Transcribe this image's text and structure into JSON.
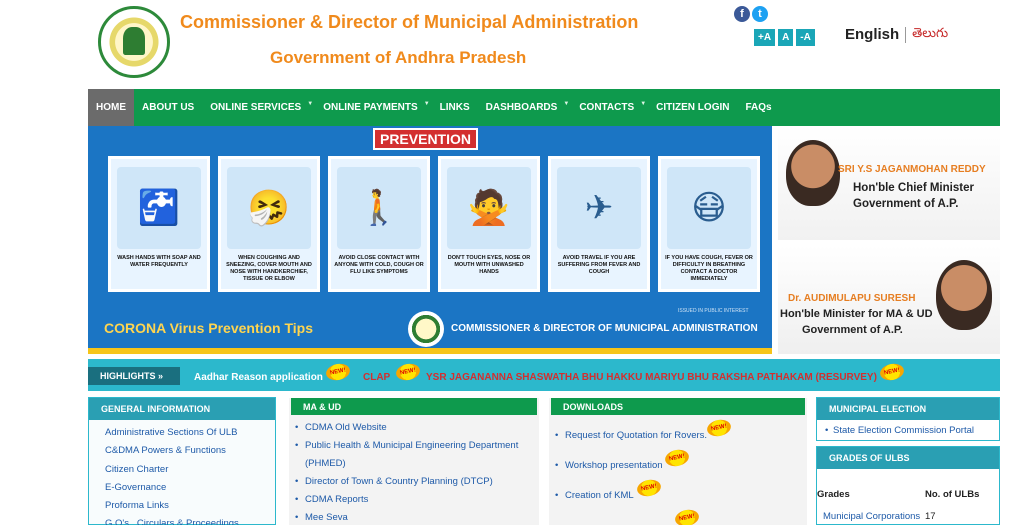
{
  "header": {
    "title_line1": "Commissioner & Director of Municipal Administration",
    "title_line2": "Government of Andhra Pradesh",
    "social": {
      "facebook": "f",
      "twitter": "t"
    },
    "font_sizes": [
      "+A",
      "A",
      "-A"
    ],
    "lang_en": "English",
    "lang_te": "తెలుగు"
  },
  "nav": {
    "items": [
      "HOME",
      "ABOUT US",
      "ONLINE SERVICES",
      "ONLINE PAYMENTS",
      "LINKS",
      "DASHBOARDS",
      "CONTACTS",
      "CITIZEN LOGIN",
      "FAQs"
    ],
    "active": "HOME"
  },
  "banner": {
    "heading": "PREVENTION",
    "cards": [
      {
        "icon": "🚰",
        "caption": "WASH HANDS WITH SOAP AND WATER FREQUENTLY"
      },
      {
        "icon": "🤧",
        "caption": "WHEN COUGHING AND SNEEZING, COVER MOUTH AND NOSE WITH HANDKERCHIEF, TISSUE OR ELBOW"
      },
      {
        "icon": "🚶",
        "caption": "AVOID CLOSE CONTACT WITH ANYONE WITH COLD, COUGH OR FLU LIKE SYMPTOMS"
      },
      {
        "icon": "🙅",
        "caption": "DON'T TOUCH EYES, NOSE OR MOUTH WITH UNWASHED HANDS"
      },
      {
        "icon": "✈",
        "caption": "AVOID TRAVEL IF YOU ARE SUFFERING FROM FEVER AND COUGH"
      },
      {
        "icon": "😷",
        "caption": "IF YOU HAVE COUGH, FEVER OR DIFFICULTY IN BREATHING CONTACT A DOCTOR IMMEDIATELY"
      }
    ],
    "watermark": "ISSUED IN PUBLIC INTEREST",
    "tips": "CORONA Virus Prevention Tips",
    "org": "COMMISSIONER & DIRECTOR OF MUNICIPAL ADMINISTRATION"
  },
  "cm": {
    "name": "SRI Y.S JAGANMOHAN REDDY",
    "role1": "Hon'ble Chief Minister",
    "role2": "Government of A.P."
  },
  "minister": {
    "name": "Dr. AUDIMULAPU SURESH",
    "role1": "Hon'ble Minister for MA & UD",
    "role2": "Government of A.P."
  },
  "highlights": {
    "label": "HIGHLIGHTS »",
    "item1": "Aadhar Reason application",
    "item2": "CLAP",
    "item3": "YSR JAGANANNA SHASWATHA BHU HAKKU MARIYU BHU RAKSHA PATHAKAM (RESURVEY)",
    "new_badge": "NEW!"
  },
  "general_info": {
    "title": "GENERAL INFORMATION",
    "items": [
      "Administrative Sections Of ULB",
      "C&DMA Powers & Functions",
      "Citizen Charter",
      "E-Governance",
      "Proforma Links",
      "G.O's , Circulars & Proceedings"
    ]
  },
  "maud": {
    "title": "MA & UD",
    "items": [
      "CDMA Old Website",
      "Public Health & Municipal Engineering Department (PHMED)",
      "Director of Town & Country Planning (DTCP)",
      "CDMA Reports",
      "Mee Seva"
    ]
  },
  "downloads": {
    "title": "DOWNLOADS",
    "items": [
      "Request for Quotation for Rovers.",
      "Workshop presentation",
      "Creation of KML"
    ]
  },
  "municipal_election": {
    "title": "MUNICIPAL ELECTION",
    "items": [
      "State Election Commission Portal"
    ]
  },
  "grades": {
    "title": "GRADES OF ULBS",
    "col1": "Grades",
    "col2": "No. of ULBs",
    "rows": [
      {
        "grade": "Municipal Corporations",
        "count": "17"
      }
    ]
  }
}
